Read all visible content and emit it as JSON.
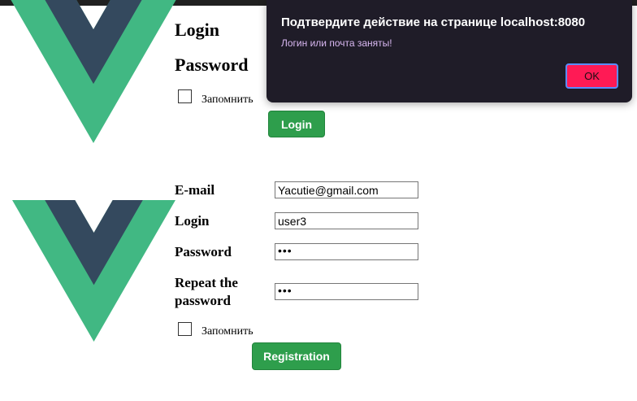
{
  "colors": {
    "vue_green": "#41b883",
    "vue_dark": "#34495e",
    "button_green": "#2e9e4c",
    "dialog_bg": "#1f1c28",
    "dialog_message": "#d9b8f2",
    "ok_button": "#ff1a55"
  },
  "login_form": {
    "logo_icon": "vue-logo",
    "login_label": "Login",
    "password_label": "Password",
    "remember_label": "Запомнить",
    "remember_checked": false,
    "submit_label": "Login"
  },
  "registration_form": {
    "logo_icon": "vue-logo",
    "email_label": "E-mail",
    "email_value": "Yacutie@gmail.com",
    "login_label": "Login",
    "login_value": "user3",
    "password_label": "Password",
    "password_value": "•••",
    "repeat_label_line1": "Repeat the",
    "repeat_label_line2": "password",
    "repeat_value": "•••",
    "remember_label": "Запомнить",
    "remember_checked": false,
    "submit_label": "Registration"
  },
  "dialog": {
    "title": "Подтвердите действие на странице localhost:8080",
    "message": "Логин или почта заняты!",
    "ok_label": "OK"
  }
}
